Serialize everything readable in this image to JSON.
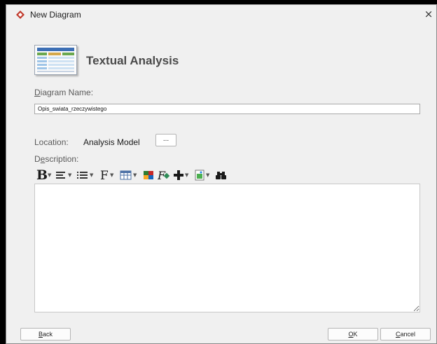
{
  "window": {
    "title": "New Diagram",
    "close_glyph": "×"
  },
  "header": {
    "title": "Textual Analysis",
    "icon": "diagram-preview-icon"
  },
  "form": {
    "diagram_name_label_first": "D",
    "diagram_name_label_rest": "iagram Name:",
    "diagram_name_value": "Opis_swiata_rzeczywistego",
    "location_label": "Location:",
    "location_value": "Analysis Model",
    "location_browse": "...",
    "description_label_first": "D",
    "description_label_underlined": "e",
    "description_label_rest": "scription:",
    "description_value": ""
  },
  "toolbar": {
    "icons": [
      "bold-icon",
      "align-icon",
      "list-icon",
      "font-icon",
      "table-icon",
      "color-icon",
      "clear-format-icon",
      "insert-icon",
      "image-icon",
      "find-icon"
    ]
  },
  "footer": {
    "back_first": "B",
    "back_rest": "ack",
    "ok_first": "O",
    "ok_rest": "K",
    "cancel_first": "C",
    "cancel_rest": "ancel"
  },
  "colors": {
    "dialog_bg": "#f0f0f0",
    "app_icon": "#c0392b",
    "backdrop": "#000000"
  }
}
